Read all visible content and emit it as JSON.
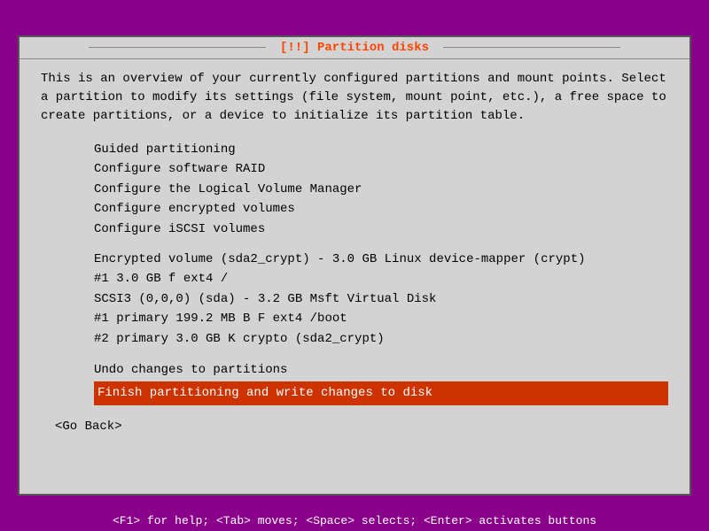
{
  "window": {
    "title": "[!!] Partition disks"
  },
  "description": "This is an overview of your currently configured partitions and mount points. Select a partition to modify its settings (file system, mount point, etc.), a free space to create partitions, or a device to initialize its partition table.",
  "menu": {
    "items": [
      {
        "label": "Guided partitioning"
      },
      {
        "label": "Configure software RAID"
      },
      {
        "label": "Configure the Logical Volume Manager"
      },
      {
        "label": "Configure encrypted volumes"
      },
      {
        "label": "Configure iSCSI volumes"
      }
    ]
  },
  "partitions": [
    {
      "label": "Encrypted volume (sda2_crypt) - 3.0 GB Linux device-mapper (crypt)"
    },
    {
      "label": "      #1        3.0 GB     f  ext4       /"
    },
    {
      "label": "SCSI3 (0,0,0) (sda) - 3.2 GB Msft Virtual Disk"
    },
    {
      "label": "      #1  primary   199.2 MB  B  F  ext4     /boot"
    },
    {
      "label": "      #2  primary     3.0 GB     K  crypto   (sda2_crypt)"
    }
  ],
  "actions": {
    "undo_label": "Undo changes to partitions",
    "finish_label": "Finish partitioning and write changes to disk"
  },
  "go_back": "<Go Back>",
  "status_bar": "<F1> for help; <Tab> moves; <Space> selects; <Enter> activates buttons"
}
